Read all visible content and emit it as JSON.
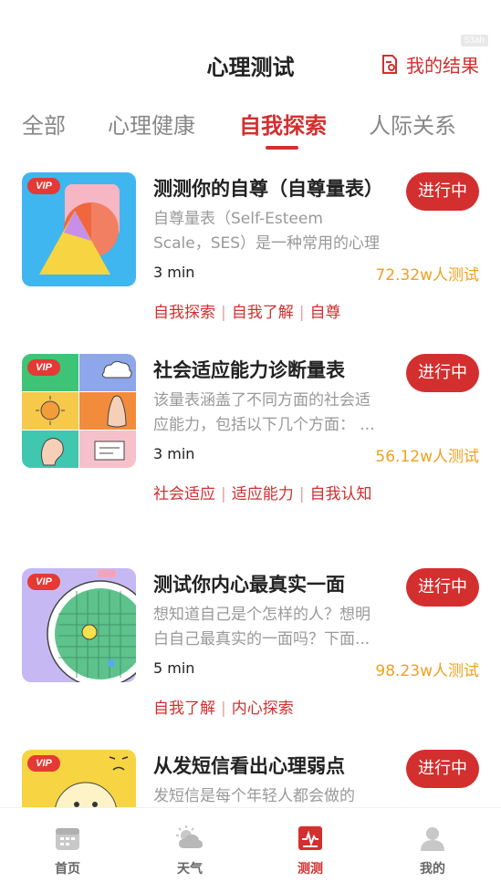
{
  "status_bar": {
    "badge": "53ah"
  },
  "header": {
    "title": "心理测试",
    "my_results": "我的结果"
  },
  "tabs": [
    {
      "label": "全部"
    },
    {
      "label": "心理健康"
    },
    {
      "label": "自我探索"
    },
    {
      "label": "人际关系"
    }
  ],
  "active_tab": "自我探索",
  "cards": [
    {
      "vip": "VIP",
      "title": "测测你的自尊（自尊量表）",
      "desc": "自尊量表（Self-Esteem Scale，SES）是一种常用的心理测量...",
      "status": "进行中",
      "duration": "3 min",
      "count": "72.32w人测试",
      "tags": [
        "自我探索",
        "自我了解",
        "自尊"
      ]
    },
    {
      "vip": "VIP",
      "title": "社会适应能力诊断量表",
      "desc": "该量表涵盖了不同方面的社会适应能力，包括以下几个方面： ...",
      "status": "进行中",
      "duration": "3 min",
      "count": "56.12w人测试",
      "tags": [
        "社会适应",
        "适应能力",
        "自我认知"
      ]
    },
    {
      "vip": "VIP",
      "title": "测试你内心最真实一面",
      "desc": "想知道自己是个怎样的人？想明白自己最真实的一面吗？下面...",
      "status": "进行中",
      "duration": "5 min",
      "count": "98.23w人测试",
      "tags": [
        "自我了解",
        "内心探索"
      ]
    },
    {
      "vip": "VIP",
      "title": "从发短信看出心理弱点",
      "desc": "发短信是每个年轻人都会做的",
      "status": "进行中"
    }
  ],
  "bottom_nav": [
    {
      "label": "首页",
      "icon": "calendar-icon"
    },
    {
      "label": "天气",
      "icon": "weather-icon"
    },
    {
      "label": "测测",
      "icon": "test-icon"
    },
    {
      "label": "我的",
      "icon": "profile-icon"
    }
  ],
  "colors": {
    "accent": "#d32f2f",
    "count": "#f0a020"
  }
}
